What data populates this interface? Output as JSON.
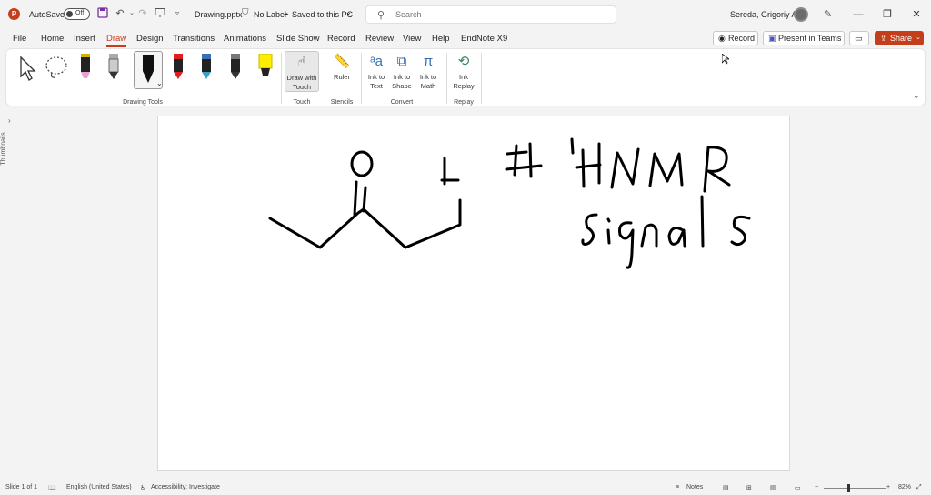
{
  "titlebar": {
    "app_logo": "P",
    "autosave_label": "AutoSave",
    "autosave_state": "Off",
    "filename": "Drawing.pptx",
    "label_status": "No Label",
    "save_status": "Saved to this PC",
    "search_placeholder": "Search",
    "user_name": "Sereda, Grigoriy A",
    "icons": [
      "save-icon",
      "undo-icon",
      "redo-icon",
      "slideshow-from-beginning-icon",
      "customize-qat-icon",
      "pen-icon",
      "minimize-icon",
      "restore-icon",
      "close-icon"
    ]
  },
  "tabs": [
    {
      "label": "File"
    },
    {
      "label": "Home"
    },
    {
      "label": "Insert"
    },
    {
      "label": "Draw",
      "active": true
    },
    {
      "label": "Design"
    },
    {
      "label": "Transitions"
    },
    {
      "label": "Animations"
    },
    {
      "label": "Slide Show"
    },
    {
      "label": "Record"
    },
    {
      "label": "Review"
    },
    {
      "label": "View"
    },
    {
      "label": "Help"
    },
    {
      "label": "EndNote X9"
    }
  ],
  "header_buttons": {
    "record": "Record",
    "present_in_teams": "Present in Teams",
    "share": "Share"
  },
  "ribbon": {
    "groups": {
      "drawing_tools": "Drawing Tools",
      "touch": "Touch",
      "stencils": "Stencils",
      "convert": "Convert",
      "replay": "Replay"
    },
    "buttons": {
      "draw_with_touch": "Draw with Touch",
      "ruler": "Ruler",
      "ink_to_text": "Ink to Text",
      "ink_to_shape": "Ink to Shape",
      "ink_to_math": "Ink to Math",
      "ink_replay": "Ink Replay"
    },
    "pens": [
      {
        "name": "pencil-pink",
        "color": "#e8a0d8"
      },
      {
        "name": "pen-gray",
        "color": "#8a8a8a"
      },
      {
        "name": "pen-black-selected",
        "color": "#111111"
      },
      {
        "name": "pen-red",
        "color": "#e01e1e"
      },
      {
        "name": "pen-galaxy",
        "color": "#3a6fb5"
      },
      {
        "name": "pen-dark",
        "color": "#333333"
      },
      {
        "name": "highlighter-yellow",
        "color": "#ffff00"
      }
    ]
  },
  "sidebar": {
    "thumbnails_label": "Thumbnails"
  },
  "slide": {
    "ink_text_1": "# ¹HNMR",
    "ink_text_2": "signals"
  },
  "statusbar": {
    "slide_info": "Slide 1 of 1",
    "language": "English (United States)",
    "accessibility": "Accessibility: Investigate",
    "notes": "Notes",
    "zoom": "82%"
  },
  "colors": {
    "accent": "#c43e1c",
    "background": "#f3f3f3"
  }
}
